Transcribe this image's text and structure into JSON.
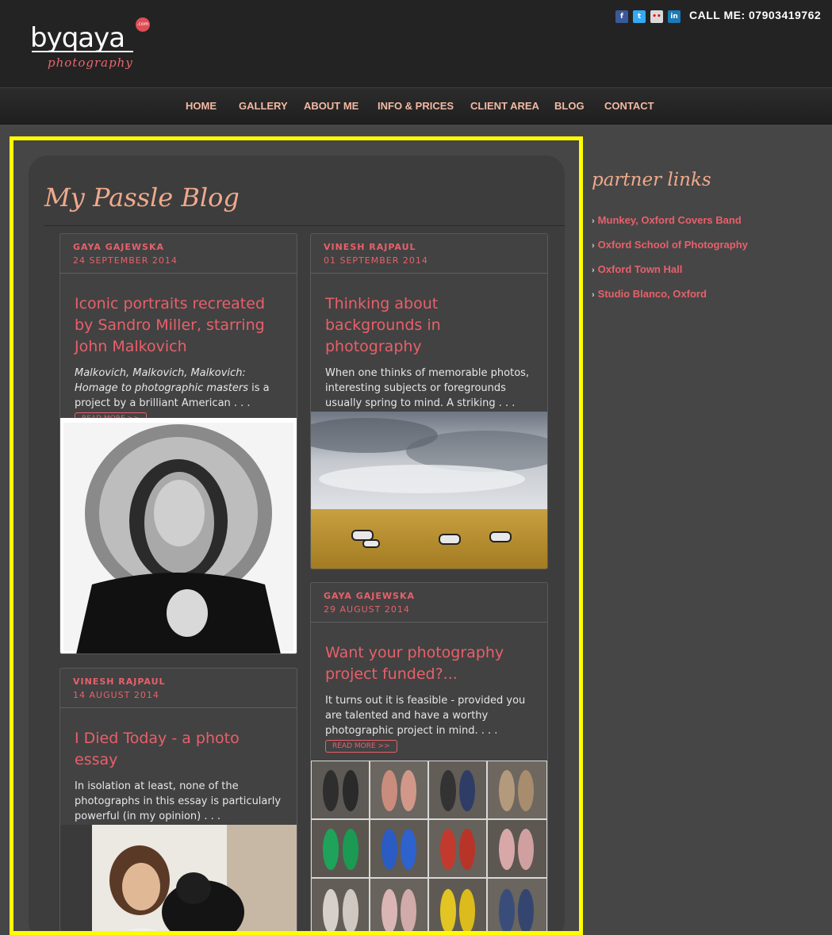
{
  "brand": {
    "logo_main": "byqaya",
    "logo_dot": ".com",
    "logo_sub": "photography"
  },
  "header": {
    "social": [
      {
        "icon": "facebook-icon",
        "glyph": "f"
      },
      {
        "icon": "twitter-icon",
        "glyph": "t"
      },
      {
        "icon": "flickr-icon",
        "glyph": "••"
      },
      {
        "icon": "linkedin-icon",
        "glyph": "in"
      }
    ],
    "call": "CALL ME: 07903419762"
  },
  "nav": [
    "HOME",
    "GALLERY",
    "ABOUT ME",
    "INFO & PRICES",
    "CLIENT AREA",
    "BLOG",
    "CONTACT"
  ],
  "blog": {
    "title": "My Passle Blog",
    "read_more": "READ MORE >>",
    "posts": [
      {
        "author": "GAYA GAJEWSKA",
        "date": "24 SEPTEMBER 2014",
        "title": "Iconic portraits recreated by Sandro Miller, starring John Malkovich",
        "excerpt_em": "Malkovich, Malkovich, Malkovich: Homage to photographic masters",
        "excerpt": " is a project by a brilliant American . . . ",
        "image": "fur-hood-portrait"
      },
      {
        "author": "VINESH RAJPAUL",
        "date": "01 SEPTEMBER 2014",
        "title": "Thinking about backgrounds in photography",
        "excerpt": "When one thinks of memorable photos, interesting subjects or foregrounds usually spring to mind. A striking . . .",
        "image": "zebras-savanna"
      },
      {
        "author": "VINESH RAJPAUL",
        "date": "14 AUGUST 2014",
        "title": "I Died Today - a photo essay",
        "excerpt": "In isolation at least, none of the photographs in this essay is particularly powerful (in my opinion) . . .",
        "image": "woman-with-dog"
      },
      {
        "author": "GAYA GAJEWSKA",
        "date": "29 AUGUST 2014",
        "title": "Want your photography project funded?...",
        "excerpt": "It turns out it is feasible - provided you are talented and have a worthy photographic project in mind. . . .",
        "image": "shoes-grid"
      }
    ]
  },
  "sidebar": {
    "title": "partner links",
    "links": [
      "Munkey, Oxford Covers Band",
      "Oxford School of Photography",
      "Oxford Town Hall",
      "Studio Blanco, Oxford"
    ]
  },
  "colors": {
    "accent": "#e8606a",
    "heading": "#f0a98c",
    "highlight_frame": "#fdfd00"
  }
}
